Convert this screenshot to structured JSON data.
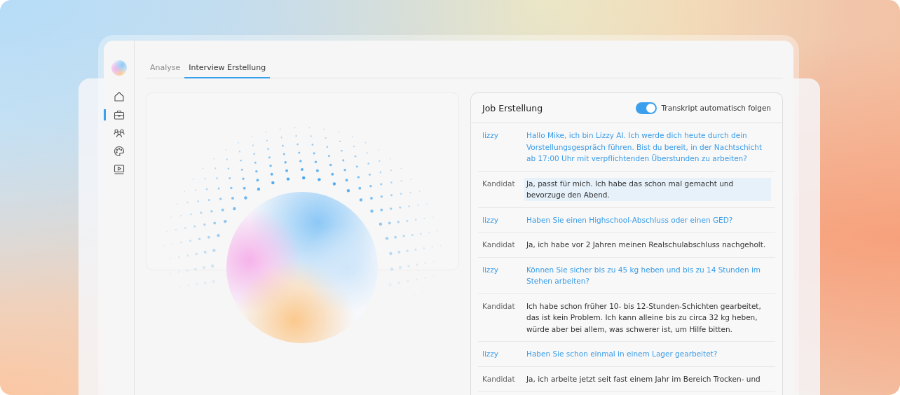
{
  "sidebar": {
    "items": [
      {
        "kind": "home",
        "selected": false
      },
      {
        "kind": "briefcase",
        "selected": true
      },
      {
        "kind": "people",
        "selected": false
      },
      {
        "kind": "palette",
        "selected": false
      },
      {
        "kind": "video",
        "selected": false
      }
    ]
  },
  "tabs": [
    {
      "label": "Analyse",
      "selected": false
    },
    {
      "label": "Interview Erstellung",
      "selected": true
    }
  ],
  "transcript": {
    "title": "Job Erstellung",
    "toggle": {
      "label": "Transkript automatisch folgen",
      "on": true
    },
    "rows": [
      {
        "kind": "ai",
        "speaker": "lizzy",
        "text": "Hallo Mike, ich bin Lizzy AI. Ich werde dich heute durch dein Vorstellungsgespräch führen. Bist du bereit, in der Nachtschicht ab 17:00 Uhr mit verpflichtenden Überstunden zu arbeiten?",
        "selected": false
      },
      {
        "kind": "candidate",
        "speaker": "Kandidat",
        "text": "Ja, passt für mich. Ich habe das schon mal gemacht und bevorzuge den Abend.",
        "selected": true
      },
      {
        "kind": "ai",
        "speaker": "lizzy",
        "text": "Haben Sie einen Highschool-Abschluss oder einen GED?",
        "selected": false
      },
      {
        "kind": "candidate",
        "speaker": "Kandidat",
        "text": "Ja, ich habe vor 2 Jahren meinen Realschulabschluss nachgeholt.",
        "selected": false
      },
      {
        "kind": "ai",
        "speaker": "lizzy",
        "text": "Können Sie sicher bis zu 45 kg heben und bis zu 14 Stunden im Stehen arbeiten?",
        "selected": false
      },
      {
        "kind": "candidate",
        "speaker": "Kandidat",
        "text": "Ich habe schon früher 10- bis 12-Stunden-Schichten gearbeitet, das ist kein Problem. Ich kann alleine bis zu circa 32 kg heben, würde aber bei allem, was schwerer ist, um Hilfe bitten.",
        "selected": false
      },
      {
        "kind": "ai",
        "speaker": "lizzy",
        "text": "Haben Sie schon einmal in einem Lager gearbeitet?",
        "selected": false
      },
      {
        "kind": "candidate",
        "speaker": "Kandidat",
        "text": "Ja, ich arbeite jetzt seit fast einem Jahr im Bereich Trocken- und",
        "selected": false
      }
    ]
  }
}
